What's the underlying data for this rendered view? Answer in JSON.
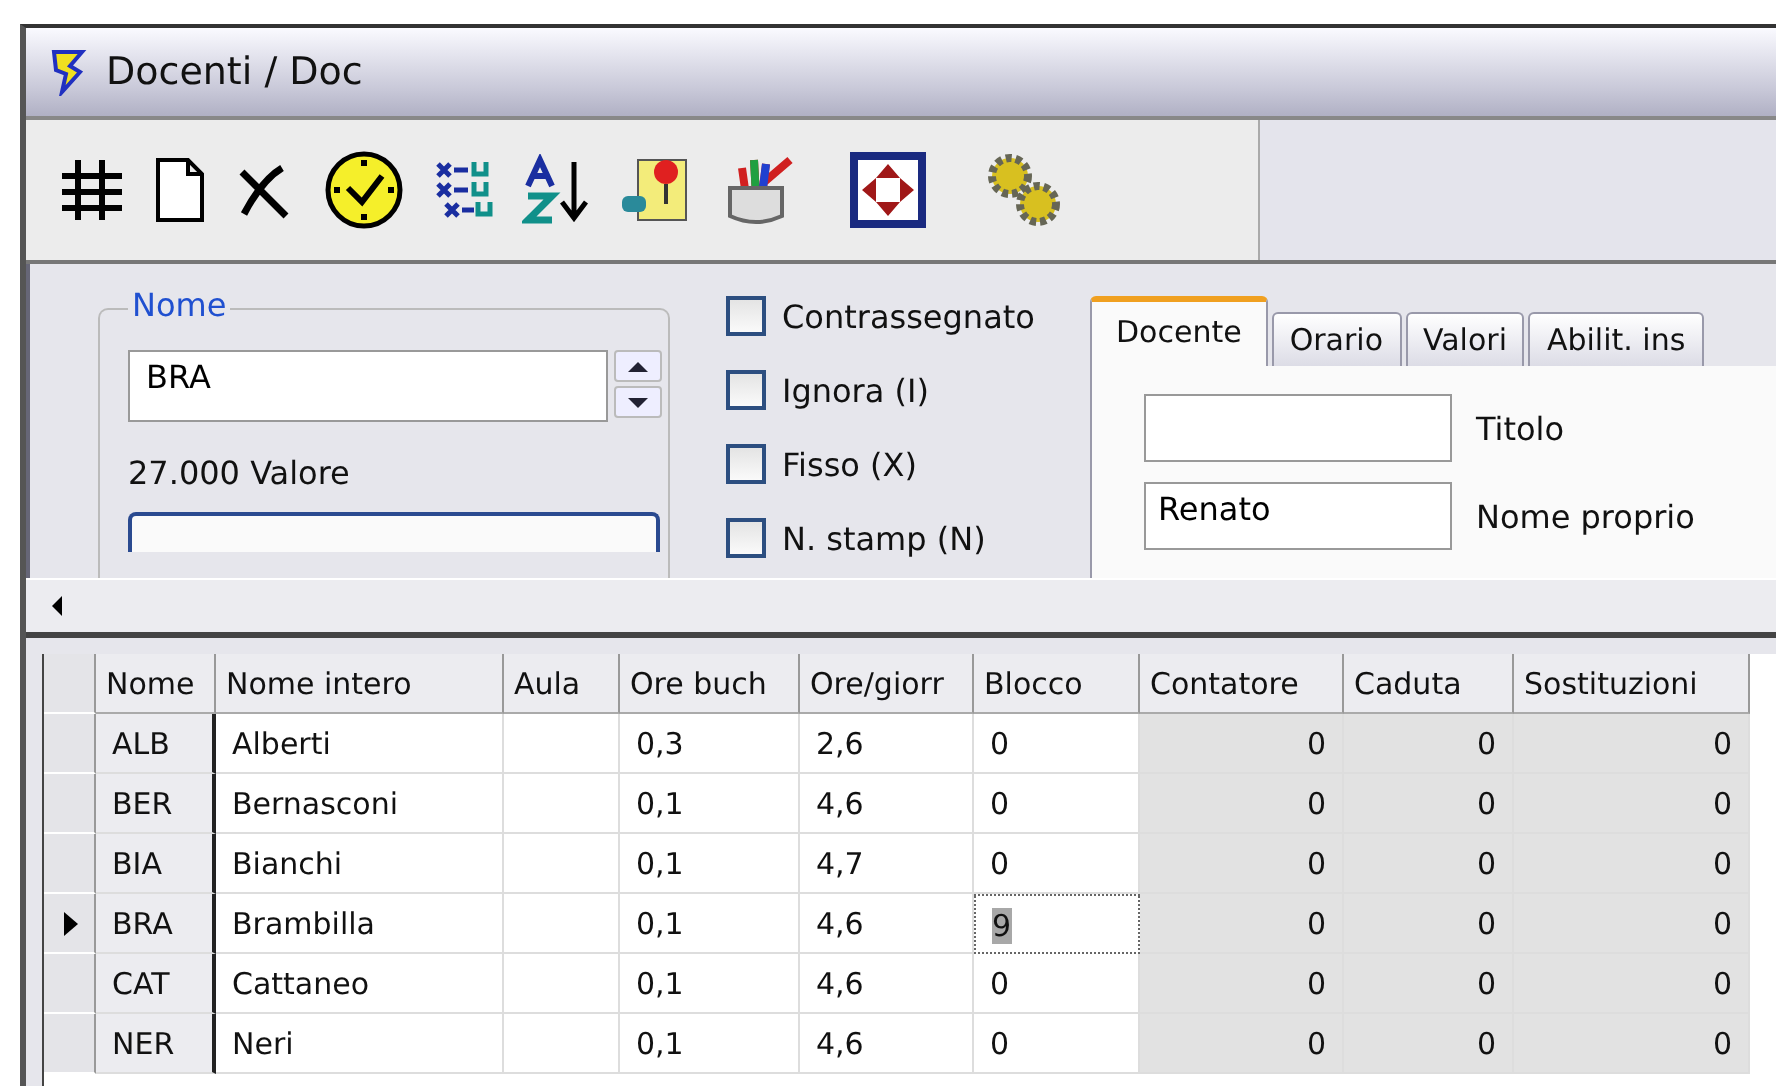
{
  "window": {
    "title": "Docenti / Doc"
  },
  "form": {
    "name_group": {
      "label": "Nome",
      "value": "BRA",
      "value_text": "27.000 Valore"
    },
    "checkboxes": [
      {
        "label": "Contrassegnato",
        "checked": false
      },
      {
        "label": "Ignora (I)",
        "checked": false
      },
      {
        "label": "Fisso (X)",
        "checked": false
      },
      {
        "label": "N. stamp (N)",
        "checked": false
      }
    ],
    "tabs": [
      {
        "label": "Docente",
        "selected": true
      },
      {
        "label": "Orario",
        "selected": false
      },
      {
        "label": "Valori",
        "selected": false
      },
      {
        "label": "Abilit. ins",
        "selected": false
      }
    ],
    "fields": [
      {
        "label": "Titolo"
      },
      {
        "value": "Renato",
        "label": "Nome proprio"
      }
    ]
  },
  "grid": {
    "columns": [
      {
        "label": "Nome",
        "readonly": false
      },
      {
        "label": "Nome intero",
        "readonly": false
      },
      {
        "label": "Aula",
        "readonly": false
      },
      {
        "label": "Ore buch",
        "readonly": false
      },
      {
        "label": "Ore/giorr",
        "readonly": false
      },
      {
        "label": "Blocco",
        "readonly": false
      },
      {
        "label": "Contatore",
        "readonly": true
      },
      {
        "label": "Caduta",
        "readonly": true
      },
      {
        "label": "Sostituzioni",
        "readonly": true
      }
    ],
    "rows": [
      {
        "current": false,
        "cells": [
          {
            "text": "ALB",
            "selected": false
          },
          {
            "text": "Alberti",
            "selected": false
          },
          {
            "selected": false
          },
          {
            "text": "0,3",
            "selected": false
          },
          {
            "text": "2,6",
            "selected": false
          },
          {
            "text": "0",
            "selected": false
          },
          {
            "text": "0",
            "selected": false
          },
          {
            "text": "0",
            "selected": false
          },
          {
            "text": "0",
            "selected": false
          }
        ]
      },
      {
        "current": false,
        "cells": [
          {
            "text": "BER",
            "selected": false
          },
          {
            "text": "Bernasconi",
            "selected": false
          },
          {
            "selected": false
          },
          {
            "text": "0,1",
            "selected": false
          },
          {
            "text": "4,6",
            "selected": false
          },
          {
            "text": "0",
            "selected": false
          },
          {
            "text": "0",
            "selected": false
          },
          {
            "text": "0",
            "selected": false
          },
          {
            "text": "0",
            "selected": false
          }
        ]
      },
      {
        "current": false,
        "cells": [
          {
            "text": "BIA",
            "selected": false
          },
          {
            "text": "Bianchi",
            "selected": false
          },
          {
            "selected": false
          },
          {
            "text": "0,1",
            "selected": false
          },
          {
            "text": "4,7",
            "selected": false
          },
          {
            "text": "0",
            "selected": false
          },
          {
            "text": "0",
            "selected": false
          },
          {
            "text": "0",
            "selected": false
          },
          {
            "text": "0",
            "selected": false
          }
        ]
      },
      {
        "current": true,
        "cells": [
          {
            "text": "BRA",
            "selected": false
          },
          {
            "text": "Brambilla",
            "selected": false
          },
          {
            "selected": false
          },
          {
            "text": "0,1",
            "selected": false
          },
          {
            "text": "4,6",
            "selected": false
          },
          {
            "text": "9",
            "selected": true
          },
          {
            "text": "0",
            "selected": false
          },
          {
            "text": "0",
            "selected": false
          },
          {
            "text": "0",
            "selected": false
          }
        ]
      },
      {
        "current": false,
        "cells": [
          {
            "text": "CAT",
            "selected": false
          },
          {
            "text": "Cattaneo",
            "selected": false
          },
          {
            "selected": false
          },
          {
            "text": "0,1",
            "selected": false
          },
          {
            "text": "4,6",
            "selected": false
          },
          {
            "text": "0",
            "selected": false
          },
          {
            "text": "0",
            "selected": false
          },
          {
            "text": "0",
            "selected": false
          },
          {
            "text": "0",
            "selected": false
          }
        ]
      },
      {
        "current": false,
        "cells": [
          {
            "text": "NER",
            "selected": false
          },
          {
            "text": "Neri",
            "selected": false
          },
          {
            "selected": false
          },
          {
            "text": "0,1",
            "selected": false
          },
          {
            "text": "4,6",
            "selected": false
          },
          {
            "text": "0",
            "selected": false
          },
          {
            "text": "0",
            "selected": false
          },
          {
            "text": "0",
            "selected": false
          },
          {
            "text": "0",
            "selected": false
          }
        ]
      }
    ]
  }
}
